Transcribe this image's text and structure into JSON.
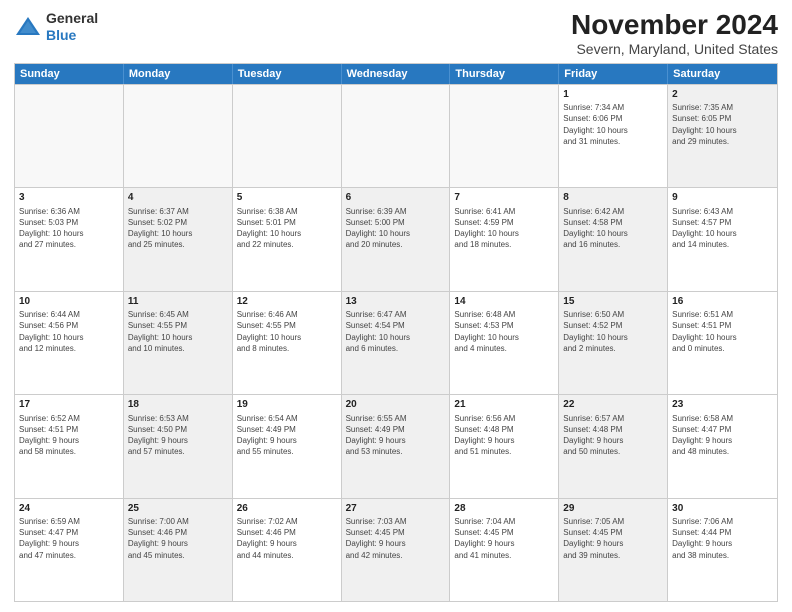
{
  "logo": {
    "general": "General",
    "blue": "Blue"
  },
  "title": "November 2024",
  "subtitle": "Severn, Maryland, United States",
  "header_days": [
    "Sunday",
    "Monday",
    "Tuesday",
    "Wednesday",
    "Thursday",
    "Friday",
    "Saturday"
  ],
  "rows": [
    [
      {
        "day": "",
        "info": "",
        "shaded": false,
        "empty": true
      },
      {
        "day": "",
        "info": "",
        "shaded": false,
        "empty": true
      },
      {
        "day": "",
        "info": "",
        "shaded": false,
        "empty": true
      },
      {
        "day": "",
        "info": "",
        "shaded": false,
        "empty": true
      },
      {
        "day": "",
        "info": "",
        "shaded": false,
        "empty": true
      },
      {
        "day": "1",
        "info": "Sunrise: 7:34 AM\nSunset: 6:06 PM\nDaylight: 10 hours\nand 31 minutes.",
        "shaded": false,
        "empty": false
      },
      {
        "day": "2",
        "info": "Sunrise: 7:35 AM\nSunset: 6:05 PM\nDaylight: 10 hours\nand 29 minutes.",
        "shaded": true,
        "empty": false
      }
    ],
    [
      {
        "day": "3",
        "info": "Sunrise: 6:36 AM\nSunset: 5:03 PM\nDaylight: 10 hours\nand 27 minutes.",
        "shaded": false,
        "empty": false
      },
      {
        "day": "4",
        "info": "Sunrise: 6:37 AM\nSunset: 5:02 PM\nDaylight: 10 hours\nand 25 minutes.",
        "shaded": true,
        "empty": false
      },
      {
        "day": "5",
        "info": "Sunrise: 6:38 AM\nSunset: 5:01 PM\nDaylight: 10 hours\nand 22 minutes.",
        "shaded": false,
        "empty": false
      },
      {
        "day": "6",
        "info": "Sunrise: 6:39 AM\nSunset: 5:00 PM\nDaylight: 10 hours\nand 20 minutes.",
        "shaded": true,
        "empty": false
      },
      {
        "day": "7",
        "info": "Sunrise: 6:41 AM\nSunset: 4:59 PM\nDaylight: 10 hours\nand 18 minutes.",
        "shaded": false,
        "empty": false
      },
      {
        "day": "8",
        "info": "Sunrise: 6:42 AM\nSunset: 4:58 PM\nDaylight: 10 hours\nand 16 minutes.",
        "shaded": true,
        "empty": false
      },
      {
        "day": "9",
        "info": "Sunrise: 6:43 AM\nSunset: 4:57 PM\nDaylight: 10 hours\nand 14 minutes.",
        "shaded": false,
        "empty": false
      }
    ],
    [
      {
        "day": "10",
        "info": "Sunrise: 6:44 AM\nSunset: 4:56 PM\nDaylight: 10 hours\nand 12 minutes.",
        "shaded": false,
        "empty": false
      },
      {
        "day": "11",
        "info": "Sunrise: 6:45 AM\nSunset: 4:55 PM\nDaylight: 10 hours\nand 10 minutes.",
        "shaded": true,
        "empty": false
      },
      {
        "day": "12",
        "info": "Sunrise: 6:46 AM\nSunset: 4:55 PM\nDaylight: 10 hours\nand 8 minutes.",
        "shaded": false,
        "empty": false
      },
      {
        "day": "13",
        "info": "Sunrise: 6:47 AM\nSunset: 4:54 PM\nDaylight: 10 hours\nand 6 minutes.",
        "shaded": true,
        "empty": false
      },
      {
        "day": "14",
        "info": "Sunrise: 6:48 AM\nSunset: 4:53 PM\nDaylight: 10 hours\nand 4 minutes.",
        "shaded": false,
        "empty": false
      },
      {
        "day": "15",
        "info": "Sunrise: 6:50 AM\nSunset: 4:52 PM\nDaylight: 10 hours\nand 2 minutes.",
        "shaded": true,
        "empty": false
      },
      {
        "day": "16",
        "info": "Sunrise: 6:51 AM\nSunset: 4:51 PM\nDaylight: 10 hours\nand 0 minutes.",
        "shaded": false,
        "empty": false
      }
    ],
    [
      {
        "day": "17",
        "info": "Sunrise: 6:52 AM\nSunset: 4:51 PM\nDaylight: 9 hours\nand 58 minutes.",
        "shaded": false,
        "empty": false
      },
      {
        "day": "18",
        "info": "Sunrise: 6:53 AM\nSunset: 4:50 PM\nDaylight: 9 hours\nand 57 minutes.",
        "shaded": true,
        "empty": false
      },
      {
        "day": "19",
        "info": "Sunrise: 6:54 AM\nSunset: 4:49 PM\nDaylight: 9 hours\nand 55 minutes.",
        "shaded": false,
        "empty": false
      },
      {
        "day": "20",
        "info": "Sunrise: 6:55 AM\nSunset: 4:49 PM\nDaylight: 9 hours\nand 53 minutes.",
        "shaded": true,
        "empty": false
      },
      {
        "day": "21",
        "info": "Sunrise: 6:56 AM\nSunset: 4:48 PM\nDaylight: 9 hours\nand 51 minutes.",
        "shaded": false,
        "empty": false
      },
      {
        "day": "22",
        "info": "Sunrise: 6:57 AM\nSunset: 4:48 PM\nDaylight: 9 hours\nand 50 minutes.",
        "shaded": true,
        "empty": false
      },
      {
        "day": "23",
        "info": "Sunrise: 6:58 AM\nSunset: 4:47 PM\nDaylight: 9 hours\nand 48 minutes.",
        "shaded": false,
        "empty": false
      }
    ],
    [
      {
        "day": "24",
        "info": "Sunrise: 6:59 AM\nSunset: 4:47 PM\nDaylight: 9 hours\nand 47 minutes.",
        "shaded": false,
        "empty": false
      },
      {
        "day": "25",
        "info": "Sunrise: 7:00 AM\nSunset: 4:46 PM\nDaylight: 9 hours\nand 45 minutes.",
        "shaded": true,
        "empty": false
      },
      {
        "day": "26",
        "info": "Sunrise: 7:02 AM\nSunset: 4:46 PM\nDaylight: 9 hours\nand 44 minutes.",
        "shaded": false,
        "empty": false
      },
      {
        "day": "27",
        "info": "Sunrise: 7:03 AM\nSunset: 4:45 PM\nDaylight: 9 hours\nand 42 minutes.",
        "shaded": true,
        "empty": false
      },
      {
        "day": "28",
        "info": "Sunrise: 7:04 AM\nSunset: 4:45 PM\nDaylight: 9 hours\nand 41 minutes.",
        "shaded": false,
        "empty": false
      },
      {
        "day": "29",
        "info": "Sunrise: 7:05 AM\nSunset: 4:45 PM\nDaylight: 9 hours\nand 39 minutes.",
        "shaded": true,
        "empty": false
      },
      {
        "day": "30",
        "info": "Sunrise: 7:06 AM\nSunset: 4:44 PM\nDaylight: 9 hours\nand 38 minutes.",
        "shaded": false,
        "empty": false
      }
    ]
  ]
}
